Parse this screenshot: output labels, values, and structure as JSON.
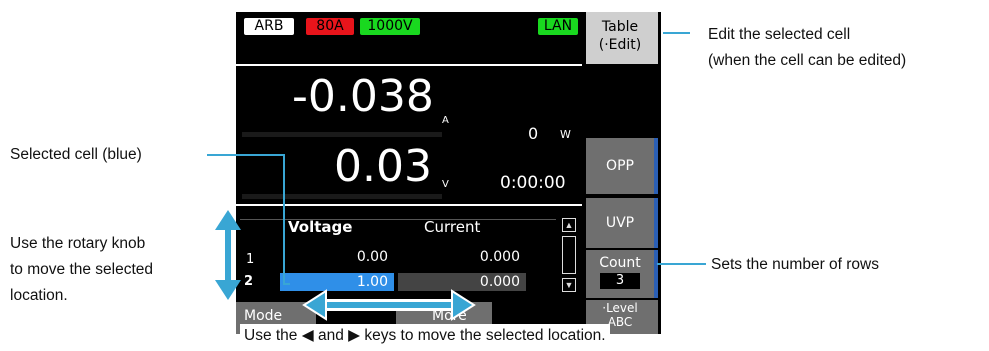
{
  "status_bar": {
    "arb": "ARB",
    "current_limit": "80A",
    "voltage_limit": "1000V",
    "interface": "LAN"
  },
  "softkeys": {
    "table": {
      "label": "Table",
      "sub": "(·Edit)"
    },
    "opp": "OPP",
    "uvp": "UVP",
    "count": {
      "label": "Count",
      "value": "3"
    },
    "level": {
      "label": "·Level",
      "sub": "ABC"
    }
  },
  "readings": {
    "current": "-0.038",
    "current_unit": "A",
    "voltage": "0.03",
    "voltage_unit": "V",
    "power": "0",
    "power_unit": "W",
    "time": "0:00:00"
  },
  "table": {
    "headers": [
      "Voltage",
      "Current"
    ],
    "rows": [
      {
        "index": "1",
        "voltage": "0.00",
        "current": "0.000"
      },
      {
        "index": "2",
        "voltage": "1.00",
        "current": "0.000"
      }
    ]
  },
  "bottom_keys": {
    "mode": "Mode",
    "more": "More"
  },
  "colors": {
    "accent": "#39a6d4",
    "selected_cell": "#2f8fe8",
    "softkey_bg": "#6f6f6f"
  },
  "annotations": {
    "edit_cell_1": "Edit the selected cell",
    "edit_cell_2": "(when the cell can be edited)",
    "selected_cell": "Selected cell (blue)",
    "rotary_1": "Use the rotary knob",
    "rotary_2": "to move the selected",
    "rotary_3": "location.",
    "rows": "Sets the number of rows",
    "keys": "Use the ◀ and ▶ keys to move the selected location."
  }
}
